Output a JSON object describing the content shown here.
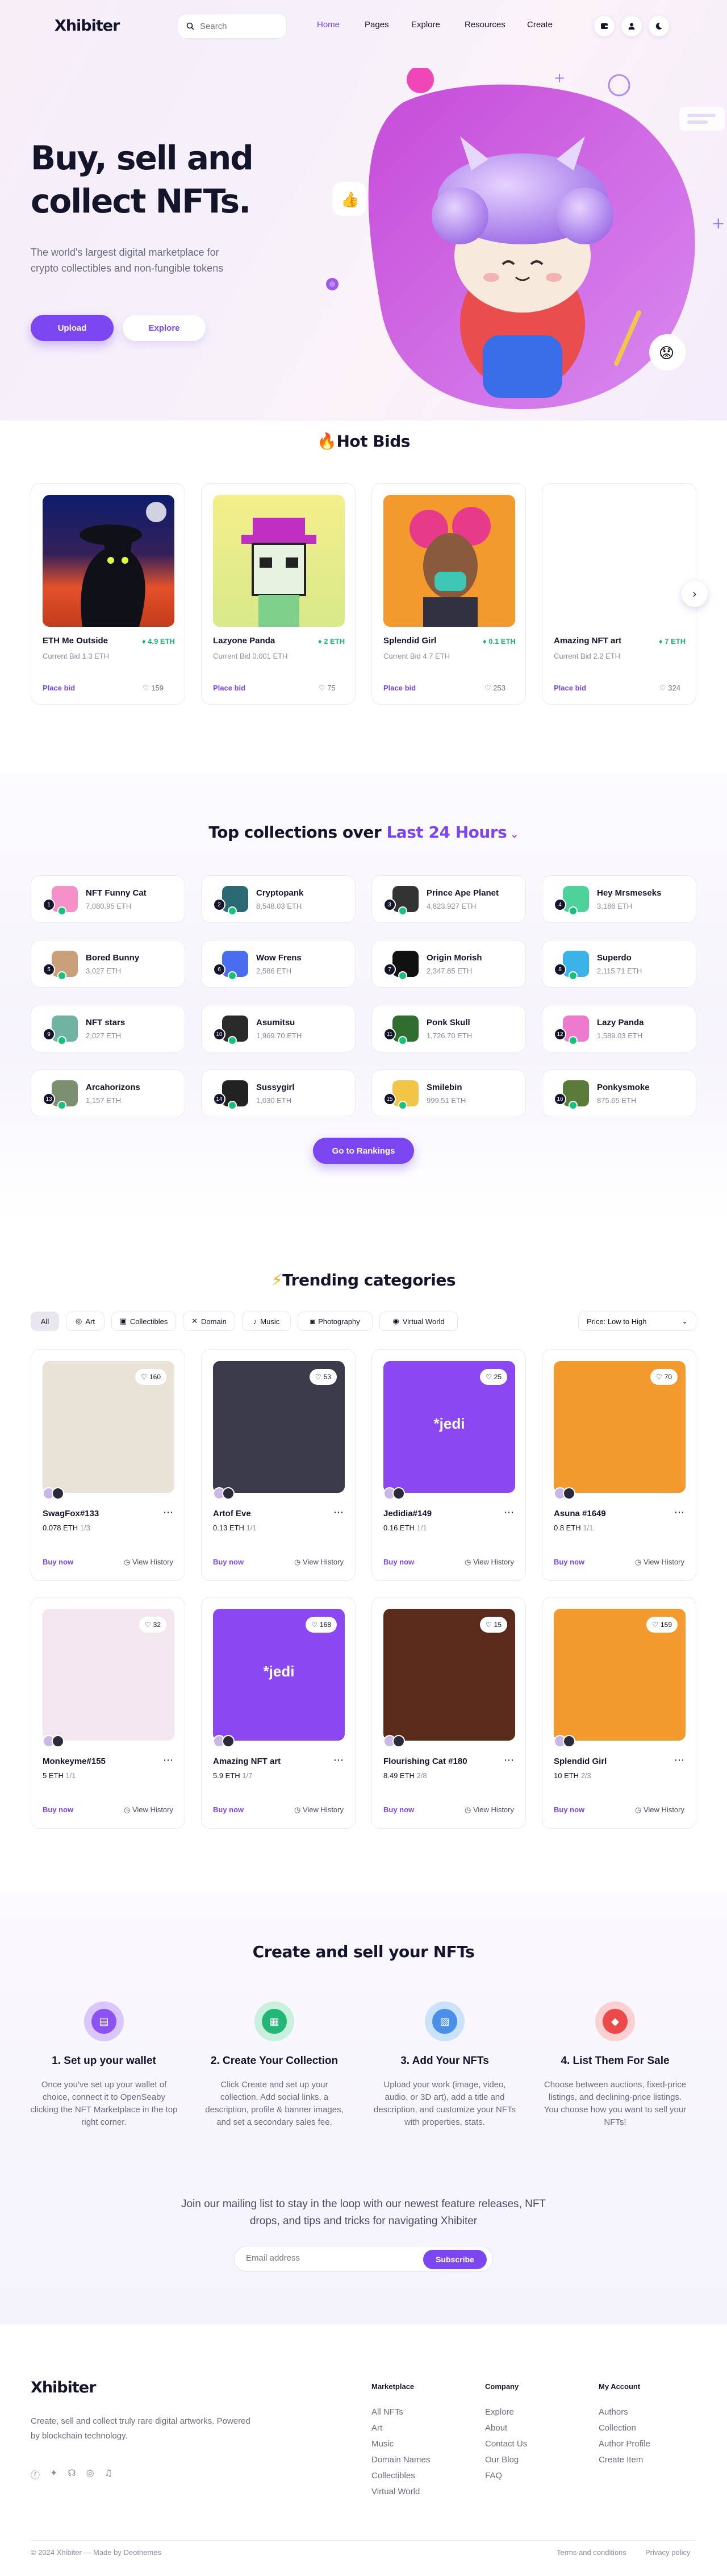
{
  "header": {
    "logo": "Xhibiter",
    "search_placeholder": "Search",
    "nav": [
      "Home",
      "Pages",
      "Explore",
      "Resources",
      "Create"
    ],
    "active": "Home"
  },
  "hero": {
    "title": "Buy, sell and collect NFTs.",
    "subtitle": "The world's largest digital marketplace for crypto collectibles and non-fungible tokens",
    "upload": "Upload",
    "explore": "Explore"
  },
  "hot_bids": {
    "title": "Hot Bids",
    "label_current": "Current Bid",
    "place_bid": "Place bid",
    "items": [
      {
        "name": "ETH Me Outside",
        "price": "4.9 ETH",
        "bid": "Current Bid 1.3 ETH",
        "likes": "159"
      },
      {
        "name": "Lazyone Panda",
        "price": "2 ETH",
        "bid": "Current Bid 0.001 ETH",
        "likes": "75"
      },
      {
        "name": "Splendid Girl",
        "price": "0.1 ETH",
        "bid": "Current Bid 4.7 ETH",
        "likes": "253"
      },
      {
        "name": "Amazing NFT art",
        "price": "7 ETH",
        "bid": "Current Bid 2.2 ETH",
        "likes": "324"
      }
    ]
  },
  "collections": {
    "title_a": "Top collections over",
    "title_b": "Last 24 Hours",
    "button": "Go to Rankings",
    "items": [
      {
        "n": "1",
        "name": "NFT Funny Cat",
        "value": "7,080.95 ETH"
      },
      {
        "n": "2",
        "name": "Cryptopank",
        "value": "8,548.03 ETH"
      },
      {
        "n": "3",
        "name": "Prince Ape Planet",
        "value": "4,823.927 ETH"
      },
      {
        "n": "4",
        "name": "Hey Mrsmeseks",
        "value": "3,186 ETH"
      },
      {
        "n": "5",
        "name": "Bored Bunny",
        "value": "3,027 ETH"
      },
      {
        "n": "6",
        "name": "Wow Frens",
        "value": "2,586 ETH"
      },
      {
        "n": "7",
        "name": "Origin Morish",
        "value": "2,347.85 ETH"
      },
      {
        "n": "8",
        "name": "Superdo",
        "value": "2,115.71 ETH"
      },
      {
        "n": "9",
        "name": "NFT stars",
        "value": "2,027 ETH"
      },
      {
        "n": "10",
        "name": "Asumitsu",
        "value": "1,969.70 ETH"
      },
      {
        "n": "11",
        "name": "Ponk Skull",
        "value": "1,726.70 ETH"
      },
      {
        "n": "12",
        "name": "Lazy Panda",
        "value": "1,589.03 ETH"
      },
      {
        "n": "13",
        "name": "Arcahorizons",
        "value": "1,157 ETH"
      },
      {
        "n": "14",
        "name": "Sussygirl",
        "value": "1,030 ETH"
      },
      {
        "n": "15",
        "name": "Smilebin",
        "value": "999.51 ETH"
      },
      {
        "n": "16",
        "name": "Ponkysmoke",
        "value": "875.65 ETH"
      }
    ]
  },
  "trending": {
    "title": "Trending categories",
    "filters": [
      "All",
      "Art",
      "Collectibles",
      "Domain",
      "Music",
      "Photography",
      "Virtual World"
    ],
    "sort": "Price: Low to High",
    "buy_now": "Buy now",
    "view_history": "View History",
    "items": [
      {
        "name": "SwagFox#133",
        "price": "0.078 ETH",
        "qty": "1/3",
        "likes": "160"
      },
      {
        "name": "Artof Eve",
        "price": "0.13 ETH",
        "qty": "1/1",
        "likes": "53"
      },
      {
        "name": "Jedidia#149",
        "price": "0.16 ETH",
        "qty": "1/1",
        "likes": "25"
      },
      {
        "name": "Asuna #1649",
        "price": "0.8 ETH",
        "qty": "1/1",
        "likes": "70"
      },
      {
        "name": "Monkeyme#155",
        "price": "5 ETH",
        "qty": "1/1",
        "likes": "32"
      },
      {
        "name": "Amazing NFT art",
        "price": "5.9 ETH",
        "qty": "1/7",
        "likes": "168"
      },
      {
        "name": "Flourishing Cat #180",
        "price": "8.49 ETH",
        "qty": "2/8",
        "likes": "15"
      },
      {
        "name": "Splendid Girl",
        "price": "10 ETH",
        "qty": "2/3",
        "likes": "159"
      }
    ]
  },
  "create": {
    "title": "Create and sell your NFTs",
    "steps": [
      {
        "title": "1. Set up your wallet",
        "desc": "Once you've set up your wallet of choice, connect it to OpenSeaby clicking the NFT Marketplace in the top right corner."
      },
      {
        "title": "2. Create Your Collection",
        "desc": "Click Create and set up your collection. Add social links, a description, profile & banner images, and set a secondary sales fee."
      },
      {
        "title": "3. Add Your NFTs",
        "desc": "Upload your work (image, video, audio, or 3D art), add a title and description, and customize your NFTs with properties, stats."
      },
      {
        "title": "4. List Them For Sale",
        "desc": "Choose between auctions, fixed-price listings, and declining-price listings. You choose how you want to sell your NFTs!"
      }
    ],
    "newsletter": "Join our mailing list to stay in the loop with our newest feature releases, NFT drops, and tips and tricks for navigating Xhibiter",
    "email_placeholder": "Email address",
    "subscribe": "Subscribe"
  },
  "footer": {
    "logo": "Xhibiter",
    "about": "Create, sell and collect truly rare digital artworks. Powered by blockchain technology.",
    "copyright": "© 2024 Xhibiter — Made by Deothemes",
    "terms": "Terms and conditions",
    "privacy": "Privacy policy",
    "col1": {
      "title": "Marketplace",
      "links": [
        "All NFTs",
        "Art",
        "Music",
        "Domain Names",
        "Collectibles",
        "Virtual World"
      ]
    },
    "col2": {
      "title": "Company",
      "links": [
        "Explore",
        "About",
        "Contact Us",
        "Our Blog",
        "FAQ"
      ]
    },
    "col3": {
      "title": "My Account",
      "links": [
        "Authors",
        "Collection",
        "Author Profile",
        "Create Item"
      ]
    }
  },
  "colors": {
    "accent": "#7b45f0",
    "green": "#15b86a",
    "dark": "#14142b"
  }
}
